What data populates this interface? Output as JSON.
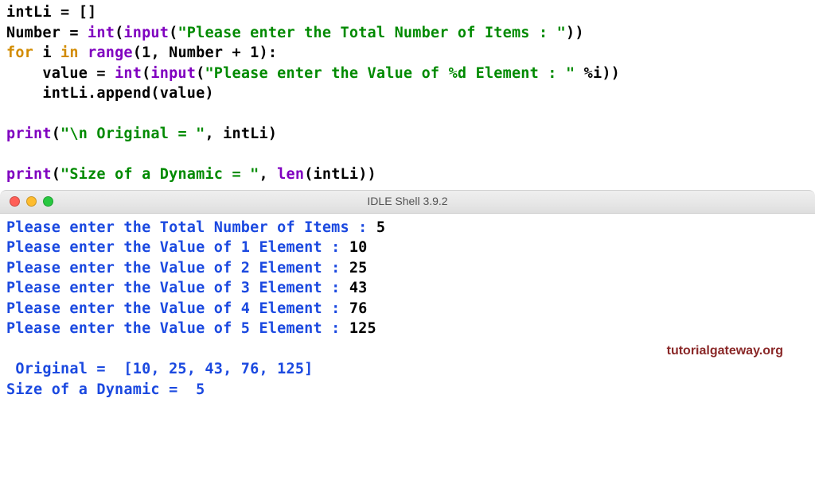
{
  "code": {
    "l1_var": "intLi",
    "l1_rest": " = []",
    "l2_var": "Number",
    "l2_eq": " = ",
    "l2_int": "int",
    "l2_op": "(",
    "l2_input": "input",
    "l2_op2": "(",
    "l2_str": "\"Please enter the Total Number of Items : \"",
    "l2_cl": "))",
    "l3_for": "for",
    "l3_sp1": " ",
    "l3_i": "i",
    "l3_sp2": " ",
    "l3_in": "in",
    "l3_sp3": " ",
    "l3_range": "range",
    "l3_args": "(1, Number + 1):",
    "l4_indent": "    value = ",
    "l4_int": "int",
    "l4_op": "(",
    "l4_input": "input",
    "l4_op2": "(",
    "l4_str": "\"Please enter the Value of %d Element : \"",
    "l4_rest": " %i))",
    "l5": "    intLi.append(value)",
    "l7_print": "print",
    "l7_op": "(",
    "l7_str": "\"\\n Original = \"",
    "l7_rest": ", intLi)",
    "l9_print": "print",
    "l9_op": "(",
    "l9_str": "\"Size of a Dynamic = \"",
    "l9_comma": ", ",
    "l9_len": "len",
    "l9_rest": "(intLi))"
  },
  "window": {
    "title": "IDLE Shell 3.9.2"
  },
  "shell": {
    "p1": "Please enter the Total Number of Items : ",
    "v1": "5",
    "p2": "Please enter the Value of 1 Element : ",
    "v2": "10",
    "p3": "Please enter the Value of 2 Element : ",
    "v3": "25",
    "p4": "Please enter the Value of 3 Element : ",
    "v4": "43",
    "p5": "Please enter the Value of 4 Element : ",
    "v5": "76",
    "p6": "Please enter the Value of 5 Element : ",
    "v6": "125",
    "out1": " Original =  [10, 25, 43, 76, 125]",
    "out2": "Size of a Dynamic =  5"
  },
  "watermark": "tutorialgateway.org"
}
